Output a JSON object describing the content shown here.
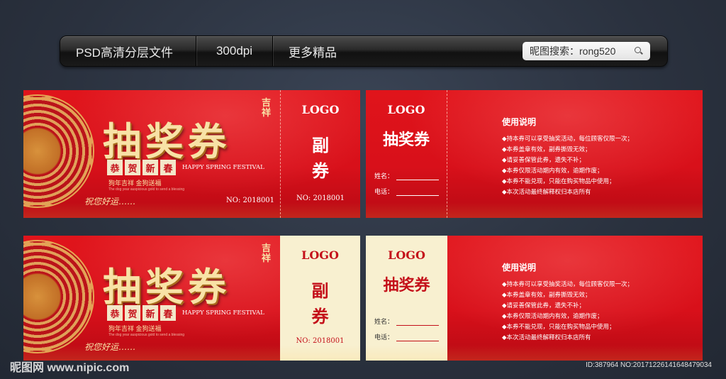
{
  "toolbar": {
    "item1": "PSD高清分层文件",
    "item2": "300dpi",
    "item3": "更多精品",
    "search_text": "昵图搜索：rong520"
  },
  "front": {
    "title": "抽奖券",
    "jixiang": "吉祥",
    "gongxi": [
      "恭",
      "贺",
      "新",
      "春"
    ],
    "happy": "HAPPY SPRING FESTIVAL",
    "blessing": "狗年吉祥  金狗送福",
    "tiny": "The dog year auspicious gold to send a blessing",
    "yuan": "祝您好运……",
    "no": "NO: 2018001"
  },
  "stub": {
    "logo": "LOGO",
    "fu": "副",
    "quan": "券",
    "no": "NO: 2018001"
  },
  "back": {
    "logo": "LOGO",
    "sub": "抽奖券",
    "name_label": "姓名：",
    "phone_label": "电话：",
    "usage_title": "使用说明",
    "rules": [
      "持本券可以享受抽奖活动，每位顾客仅限一次；",
      "本券盖章有效，副券撕毁无效；",
      "请妥善保管此券，遗失不补；",
      "本券仅限活动期内有效，逾期作废；",
      "本券不能兑现，只能在购买物品中使用；",
      "本次活动最终解释权归本店所有"
    ]
  },
  "watermark": "昵图网 www.nipic.com",
  "id_text": "ID:387964 NO:20171226141648479034"
}
